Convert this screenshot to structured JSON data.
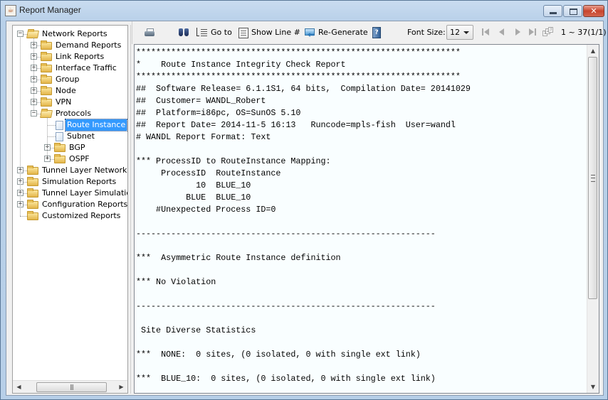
{
  "window": {
    "title": "Report Manager",
    "app_icon": "java-app-icon",
    "controls": {
      "minimize": "minimize",
      "maximize": "maximize",
      "close": "close"
    }
  },
  "tree": {
    "items": [
      {
        "label": "Network Reports",
        "level": 0,
        "type": "folder",
        "expanded": true
      },
      {
        "label": "Demand Reports",
        "level": 1,
        "type": "folder",
        "expanded": false
      },
      {
        "label": "Link Reports",
        "level": 1,
        "type": "folder",
        "expanded": false
      },
      {
        "label": "Interface Traffic",
        "level": 1,
        "type": "folder",
        "expanded": false
      },
      {
        "label": "Group",
        "level": 1,
        "type": "folder",
        "expanded": false
      },
      {
        "label": "Node",
        "level": 1,
        "type": "folder",
        "expanded": false
      },
      {
        "label": "VPN",
        "level": 1,
        "type": "folder",
        "expanded": false
      },
      {
        "label": "Protocols",
        "level": 1,
        "type": "folder",
        "expanded": true
      },
      {
        "label": "Route Instance",
        "level": 2,
        "type": "document",
        "selected": true
      },
      {
        "label": "Subnet",
        "level": 2,
        "type": "document"
      },
      {
        "label": "BGP",
        "level": 2,
        "type": "folder",
        "expanded": false
      },
      {
        "label": "OSPF",
        "level": 2,
        "type": "folder",
        "expanded": false
      },
      {
        "label": "Tunnel Layer Network Re",
        "level": 0,
        "type": "folder",
        "expanded": false
      },
      {
        "label": "Simulation Reports",
        "level": 0,
        "type": "folder",
        "expanded": false
      },
      {
        "label": "Tunnel Layer Simulation F",
        "level": 0,
        "type": "folder",
        "expanded": false
      },
      {
        "label": "Configuration Reports",
        "level": 0,
        "type": "folder",
        "expanded": false
      },
      {
        "label": "Customized Reports",
        "level": 0,
        "type": "folder",
        "leaf": true
      }
    ],
    "expand_glyph": "+",
    "collapse_glyph": "−"
  },
  "toolbar": {
    "print_icon": "printer-icon",
    "find_icon": "binoculars-icon",
    "goto_label": "Go to",
    "show_line_label": "Show Line #",
    "regenerate_label": "Re-Generate",
    "help_glyph": "?",
    "font_size_label": "Font Size:",
    "font_size_value": "12",
    "help_icon": "help-book-icon",
    "page_range": "1 ~ 37(1/1)"
  },
  "report": {
    "lines": [
      "*****************************************************************",
      "*    Route Instance Integrity Check Report",
      "*****************************************************************",
      "##  Software Release= 6.1.1S1, 64 bits,  Compilation Date= 20141029",
      "##  Customer= WANDL_Robert",
      "##  Platform=i86pc, OS=SunOS 5.10",
      "##  Report Date= 2014-11-5 16:13   Runcode=mpls-fish  User=wandl",
      "# WANDL Report Format: Text",
      "",
      "*** ProcessID to RouteInstance Mapping:",
      "     ProcessID  RouteInstance",
      "            10  BLUE_10",
      "          BLUE  BLUE_10",
      "    #Unexpected Process ID=0",
      "",
      "------------------------------------------------------------",
      "",
      "***  Asymmetric Route Instance definition",
      "",
      "*** No Violation",
      "",
      "------------------------------------------------------------",
      "",
      " Site Diverse Statistics",
      "",
      "***  NONE:  0 sites, (0 isolated, 0 with single ext link)",
      "",
      "***  BLUE_10:  0 sites, (0 isolated, 0 with single ext link)"
    ],
    "vertical_scroll_fraction": 0.0,
    "visible_fraction": 0.72
  }
}
